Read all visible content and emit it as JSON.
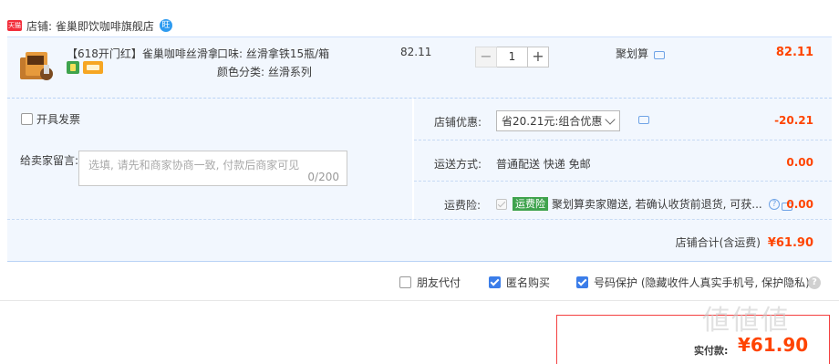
{
  "shop": {
    "badge": "天猫",
    "name": "店铺: 雀巢即饮咖啡旗舰店",
    "wangwang": "旺"
  },
  "item": {
    "title": "【618开门红】雀巢咖啡丝滑拿...",
    "sku_flavor": "口味: 丝滑拿铁15瓶/箱",
    "sku_color": "颜色分类: 丝滑系列",
    "unit_price": "82.11",
    "quantity": "1",
    "qty_minus": "−",
    "qty_plus": "+",
    "promo": "聚划算",
    "price": "82.11"
  },
  "invoice_label": "开具发票",
  "memo": {
    "label": "给卖家留言:",
    "placeholder": "选填, 请先和商家协商一致, 付款后商家可见",
    "counter": "0/200"
  },
  "shop_discount": {
    "label": "店铺优惠:",
    "selected": "省20.21元:组合优惠",
    "value": "-20.21"
  },
  "shipping": {
    "label": "运送方式:",
    "method": "普通配送 快递 免邮",
    "value": "0.00"
  },
  "insurance": {
    "label": "运费险:",
    "badge": "运费险",
    "text": "聚划算卖家赠送, 若确认收货前退货, 可获...",
    "help": "?",
    "value": "0.00"
  },
  "total": {
    "label": "店铺合计(含运费)",
    "amount": "¥61.90"
  },
  "options": {
    "friend_pay": "朋友代付",
    "anonymous": "匿名购买",
    "number_protect": "号码保护 (隐藏收件人真实手机号, 保护隐私)",
    "help": "?"
  },
  "payment": {
    "label": "实付款:",
    "amount": "¥61.90"
  },
  "watermark": "値値値"
}
